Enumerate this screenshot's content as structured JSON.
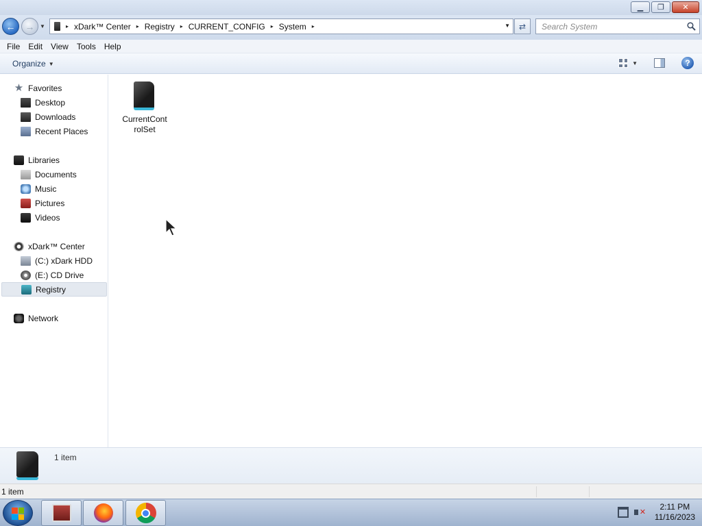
{
  "window": {
    "minimize_glyph": "▁",
    "maximize_glyph": "❐",
    "close_glyph": "✕"
  },
  "address_bar": {
    "breadcrumbs": [
      "xDark™ Center",
      "Registry",
      "CURRENT_CONFIG",
      "System"
    ],
    "separator": "▸",
    "dropdown_glyph": "▼"
  },
  "search": {
    "placeholder": "Search System"
  },
  "menu": {
    "items": [
      "File",
      "Edit",
      "View",
      "Tools",
      "Help"
    ]
  },
  "toolbar": {
    "organize_label": "Organize",
    "help_glyph": "?"
  },
  "nav_pane": {
    "favorites": {
      "label": "Favorites",
      "icon": "star-icon"
    },
    "favorites_items": [
      {
        "label": "Desktop",
        "icon": "desktop-icon"
      },
      {
        "label": "Downloads",
        "icon": "downloads-icon"
      },
      {
        "label": "Recent Places",
        "icon": "recent-places-icon"
      }
    ],
    "libraries": {
      "label": "Libraries",
      "icon": "libraries-icon"
    },
    "libraries_items": [
      {
        "label": "Documents",
        "icon": "documents-icon"
      },
      {
        "label": "Music",
        "icon": "music-icon"
      },
      {
        "label": "Pictures",
        "icon": "pictures-icon"
      },
      {
        "label": "Videos",
        "icon": "videos-icon"
      }
    ],
    "computer": {
      "label": "xDark™ Center",
      "icon": "computer-icon"
    },
    "computer_items": [
      {
        "label": "(C:) xDark HDD",
        "icon": "hard-drive-icon"
      },
      {
        "label": "(E:) CD Drive",
        "icon": "cd-drive-icon"
      },
      {
        "label": "Registry",
        "icon": "registry-icon",
        "selected": true
      }
    ],
    "network": {
      "label": "Network",
      "icon": "network-icon"
    }
  },
  "content": {
    "items": [
      {
        "name": "CurrentControlSet",
        "icon": "folder-icon"
      }
    ]
  },
  "details_pane": {
    "count_text": "1 item"
  },
  "status_bar": {
    "text": "1 item"
  },
  "taskbar": {
    "pinned": [
      {
        "name": "Windows Explorer",
        "icon": "explorer-icon"
      },
      {
        "name": "Firefox",
        "icon": "firefox-icon"
      },
      {
        "name": "Google Chrome",
        "icon": "chrome-icon"
      }
    ],
    "clock_time": "2:11 PM",
    "clock_date": "11/16/2023"
  },
  "colors": {
    "accent": "#2b6cc4",
    "selection": "#e4e9f0",
    "registry_cyan": "#39b7d8"
  }
}
